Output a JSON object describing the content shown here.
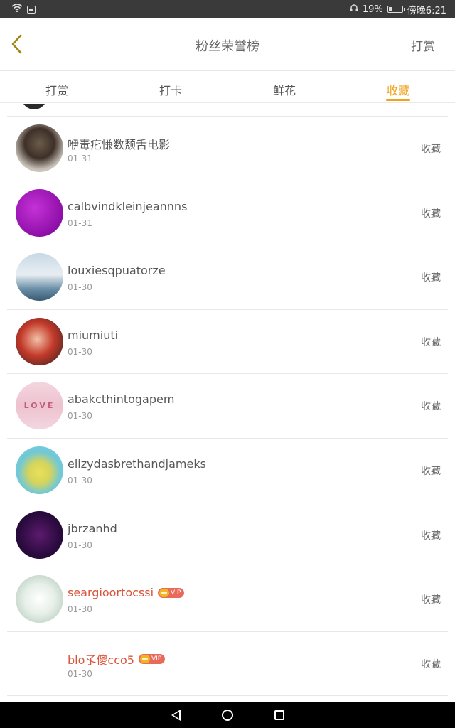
{
  "status_bar": {
    "battery": "19%",
    "time": "傍晚6:21",
    "icons": [
      "wifi-icon",
      "sim-icon",
      "headphones-icon",
      "battery-icon"
    ]
  },
  "header": {
    "title": "粉丝荣誉榜",
    "action": "打赏",
    "back_icon": "chevron-left-icon"
  },
  "tabs": [
    {
      "label": "打赏",
      "active": false
    },
    {
      "label": "打卡",
      "active": false
    },
    {
      "label": "鲜花",
      "active": false
    },
    {
      "label": "收藏",
      "active": true
    }
  ],
  "colors": {
    "accent": "#f0a21a",
    "vip_name": "#d9543b"
  },
  "list": [
    {
      "name": "咿毒疕慊数颓舌电影",
      "date": "01-31",
      "action": "收藏",
      "vip": false
    },
    {
      "name": "calbvindkleinjeannns",
      "date": "01-31",
      "action": "收藏",
      "vip": false
    },
    {
      "name": "louxiesqpuatorze",
      "date": "01-30",
      "action": "收藏",
      "vip": false
    },
    {
      "name": "miumiuti",
      "date": "01-30",
      "action": "收藏",
      "vip": false
    },
    {
      "name": "abakcthintogapem",
      "date": "01-30",
      "action": "收藏",
      "vip": false,
      "avatar_text": "LOVE"
    },
    {
      "name": "elizydasbrethandjameks",
      "date": "01-30",
      "action": "收藏",
      "vip": false
    },
    {
      "name": "jbrzanhd",
      "date": "01-30",
      "action": "收藏",
      "vip": false
    },
    {
      "name": "seargioortocssi",
      "date": "01-30",
      "action": "收藏",
      "vip": true,
      "vip_label": "VIP"
    },
    {
      "name": "blo孓傻cco5",
      "date": "01-30",
      "action": "收藏",
      "vip": true,
      "vip_label": "VIP"
    }
  ],
  "nav": {
    "icons": [
      "nav-back-icon",
      "nav-home-icon",
      "nav-recents-icon"
    ]
  }
}
